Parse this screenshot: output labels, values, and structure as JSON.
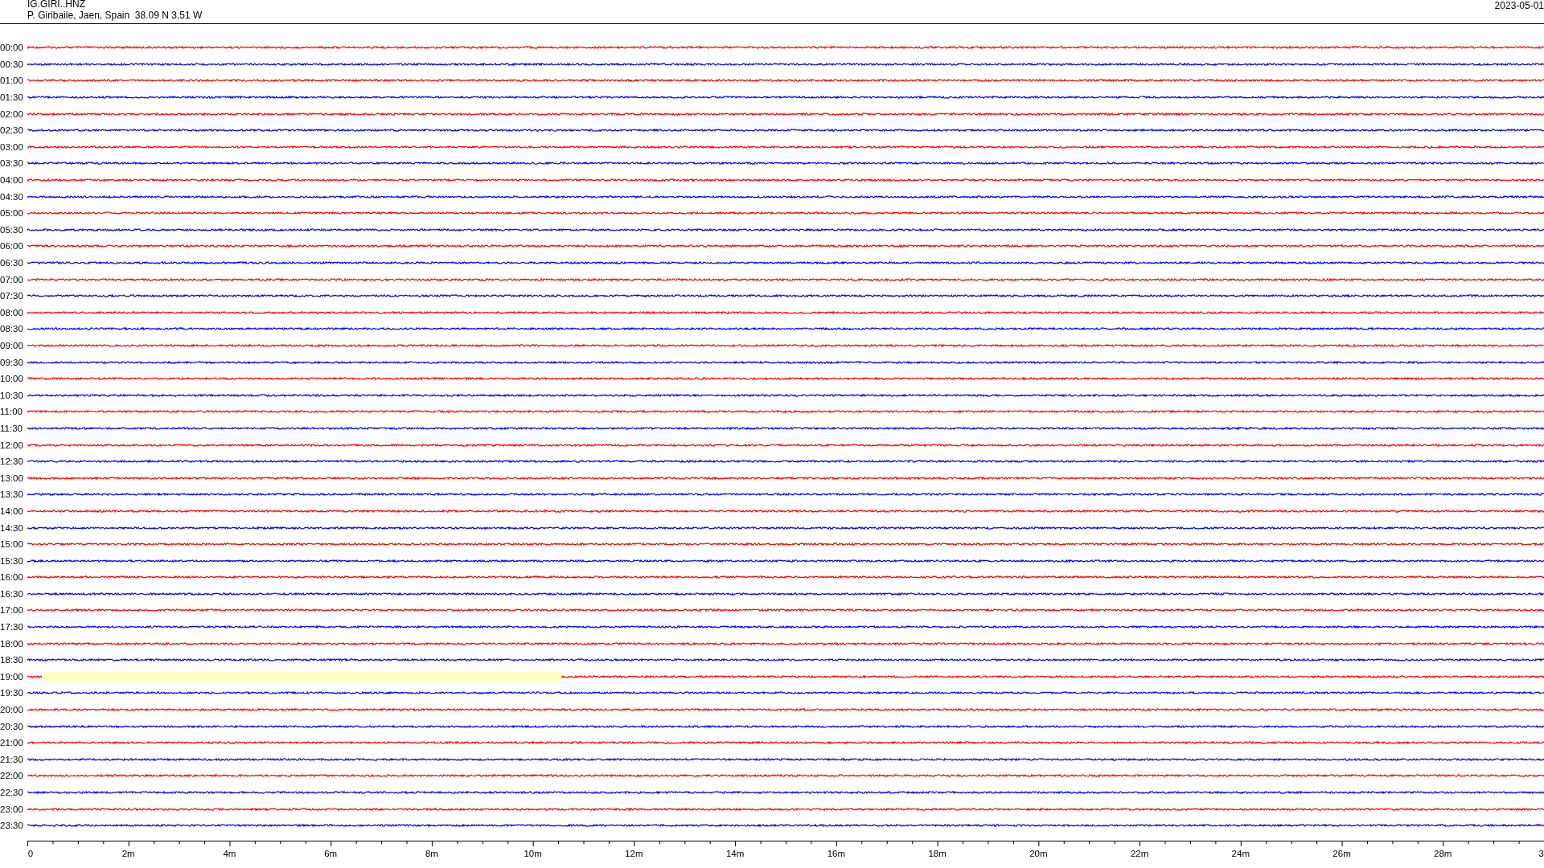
{
  "header": {
    "station": "IG.GIRI..HNZ",
    "location": "P. Giribaile, Jaen, Spain  38.09 N 3.51 W",
    "date": "2023-05-01"
  },
  "rows": [
    {
      "time": "00:00",
      "color": "#ff0000",
      "highlighted": false
    },
    {
      "time": "00:30",
      "color": "#0000ff",
      "highlighted": false
    },
    {
      "time": "01:00",
      "color": "#ff0000",
      "highlighted": false
    },
    {
      "time": "01:30",
      "color": "#0000ff",
      "highlighted": false
    },
    {
      "time": "02:00",
      "color": "#ff0000",
      "highlighted": false
    },
    {
      "time": "02:30",
      "color": "#0000ff",
      "highlighted": false
    },
    {
      "time": "03:00",
      "color": "#ff0000",
      "highlighted": false
    },
    {
      "time": "03:30",
      "color": "#0000ff",
      "highlighted": false
    },
    {
      "time": "04:00",
      "color": "#ff0000",
      "highlighted": false
    },
    {
      "time": "04:30",
      "color": "#0000ff",
      "highlighted": false
    },
    {
      "time": "05:00",
      "color": "#ff0000",
      "highlighted": false
    },
    {
      "time": "05:30",
      "color": "#0000ff",
      "highlighted": false
    },
    {
      "time": "06:00",
      "color": "#ff0000",
      "highlighted": false
    },
    {
      "time": "06:30",
      "color": "#0000ff",
      "highlighted": false
    },
    {
      "time": "07:00",
      "color": "#ff0000",
      "highlighted": false
    },
    {
      "time": "07:30",
      "color": "#0000ff",
      "highlighted": false
    },
    {
      "time": "08:00",
      "color": "#ff0000",
      "highlighted": false
    },
    {
      "time": "08:30",
      "color": "#0000ff",
      "highlighted": false
    },
    {
      "time": "09:00",
      "color": "#ff0000",
      "highlighted": false
    },
    {
      "time": "09:30",
      "color": "#0000ff",
      "highlighted": false
    },
    {
      "time": "10:00",
      "color": "#ff0000",
      "highlighted": false
    },
    {
      "time": "10:30",
      "color": "#0000ff",
      "highlighted": false
    },
    {
      "time": "11:00",
      "color": "#ff0000",
      "highlighted": false
    },
    {
      "time": "11:30",
      "color": "#0000ff",
      "highlighted": false
    },
    {
      "time": "12:00",
      "color": "#ff0000",
      "highlighted": false
    },
    {
      "time": "12:30",
      "color": "#0000ff",
      "highlighted": false
    },
    {
      "time": "13:00",
      "color": "#ff0000",
      "highlighted": false
    },
    {
      "time": "13:30",
      "color": "#0000ff",
      "highlighted": false
    },
    {
      "time": "14:00",
      "color": "#ff0000",
      "highlighted": false
    },
    {
      "time": "14:30",
      "color": "#0000ff",
      "highlighted": false
    },
    {
      "time": "15:00",
      "color": "#ff0000",
      "highlighted": false
    },
    {
      "time": "15:30",
      "color": "#0000ff",
      "highlighted": false
    },
    {
      "time": "16:00",
      "color": "#ff0000",
      "highlighted": false
    },
    {
      "time": "16:30",
      "color": "#0000ff",
      "highlighted": false
    },
    {
      "time": "17:00",
      "color": "#ff0000",
      "highlighted": false
    },
    {
      "time": "17:30",
      "color": "#0000ff",
      "highlighted": false
    },
    {
      "time": "18:00",
      "color": "#ff0000",
      "highlighted": false
    },
    {
      "time": "18:30",
      "color": "#0000ff",
      "highlighted": false
    },
    {
      "time": "19:00",
      "color": "#ff0000",
      "highlighted": true
    },
    {
      "time": "19:30",
      "color": "#0000ff",
      "highlighted": false
    },
    {
      "time": "20:00",
      "color": "#ff0000",
      "highlighted": false
    },
    {
      "time": "20:30",
      "color": "#0000ff",
      "highlighted": false
    },
    {
      "time": "21:00",
      "color": "#ff0000",
      "highlighted": false
    },
    {
      "time": "21:30",
      "color": "#0000ff",
      "highlighted": false
    },
    {
      "time": "22:00",
      "color": "#ff0000",
      "highlighted": false
    },
    {
      "time": "22:30",
      "color": "#0000ff",
      "highlighted": false
    },
    {
      "time": "23:00",
      "color": "#ff0000",
      "highlighted": false
    },
    {
      "time": "23:30",
      "color": "#0000ff",
      "highlighted": false
    }
  ],
  "x_axis": {
    "labels": [
      "0",
      "2m",
      "4m",
      "6m",
      "8m",
      "10m",
      "12m",
      "14m",
      "16m",
      "18m",
      "20m",
      "22m",
      "24m",
      "26m",
      "28m",
      "3"
    ]
  }
}
